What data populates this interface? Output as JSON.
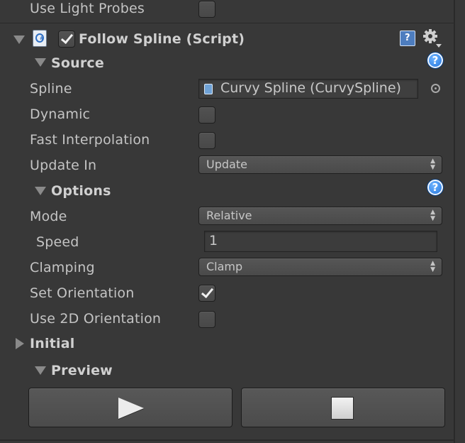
{
  "prev_component": {
    "use_light_probes_label": "Use Light Probes",
    "use_light_probes_checked": false
  },
  "component": {
    "title": "Follow Spline (Script)",
    "enabled": true,
    "script_icon": "csharp-script-icon",
    "header_icons": [
      "reference-book-icon",
      "gear-icon"
    ]
  },
  "source": {
    "header": "Source",
    "spline_label": "Spline",
    "spline_value": "Curvy Spline (CurvySpline)",
    "dynamic_label": "Dynamic",
    "dynamic_checked": false,
    "fast_interp_label": "Fast Interpolation",
    "fast_interp_checked": false,
    "update_in_label": "Update In",
    "update_in_value": "Update"
  },
  "options": {
    "header": "Options",
    "mode_label": "Mode",
    "mode_value": "Relative",
    "speed_label": "Speed",
    "speed_value": "1",
    "clamping_label": "Clamping",
    "clamping_value": "Clamp",
    "set_orientation_label": "Set Orientation",
    "set_orientation_checked": true,
    "use_2d_label": "Use 2D Orientation",
    "use_2d_checked": false
  },
  "initial": {
    "header": "Initial",
    "expanded": false
  },
  "preview": {
    "header": "Preview",
    "play_icon": "play-icon",
    "stop_icon": "stop-icon"
  },
  "colors": {
    "background": "#383838",
    "help_icon": "#1d6fd8",
    "text": "#c4c4c4"
  }
}
